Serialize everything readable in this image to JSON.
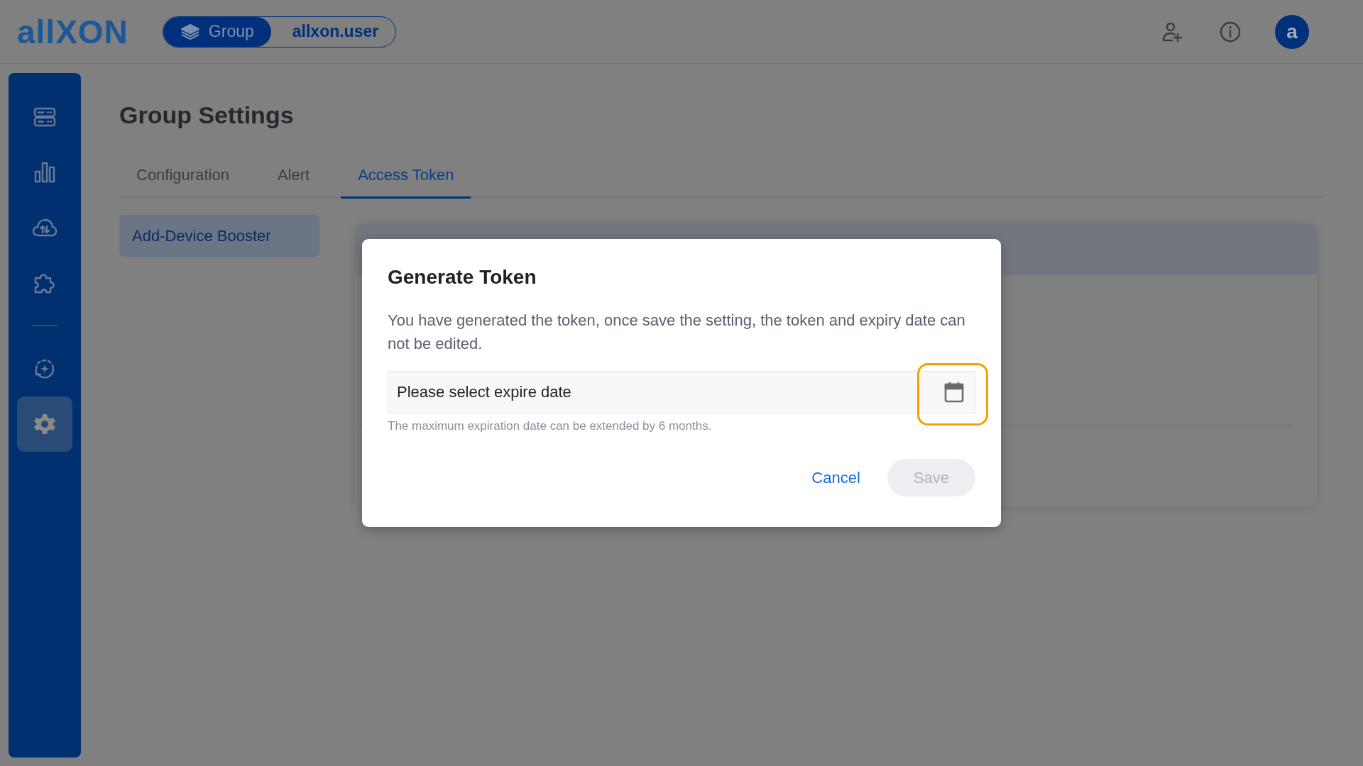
{
  "header": {
    "logo": "allXON",
    "context_switch": [
      {
        "label": "Group",
        "kind": "group",
        "selected": true
      },
      {
        "label": "allxon.user",
        "kind": "user",
        "selected": false
      }
    ],
    "actions": [
      {
        "kind": "add-user"
      },
      {
        "kind": "info"
      }
    ],
    "avatar": "a"
  },
  "sidebar": {
    "groups": [
      [
        {
          "kind": "server",
          "selected": false
        },
        {
          "kind": "chart",
          "selected": false
        },
        {
          "kind": "cloud",
          "selected": false
        },
        {
          "kind": "puzzle",
          "selected": false
        }
      ],
      [
        {
          "kind": "sync",
          "selected": false
        },
        {
          "kind": "gear",
          "selected": true
        }
      ]
    ]
  },
  "page": {
    "title": "Group Settings",
    "tabs": [
      {
        "label": "Configuration",
        "selected": false
      },
      {
        "label": "Alert",
        "selected": false
      },
      {
        "label": "Access Token",
        "selected": true
      }
    ],
    "side_menu": [
      {
        "label": "Add-Device Booster",
        "selected": true
      }
    ]
  },
  "dialog": {
    "title": "Generate Token",
    "message": "You have generated the token, once save the setting, the token and expiry date can not be edited.",
    "date_field": {
      "placeholder": "Please select expire date",
      "highlighted": true
    },
    "hint": "The maximum expiration date can be extended by 6 months.",
    "buttons": [
      {
        "label": "Cancel",
        "kind": "text",
        "disabled": false
      },
      {
        "label": "Save",
        "kind": "filled",
        "disabled": true
      }
    ]
  }
}
